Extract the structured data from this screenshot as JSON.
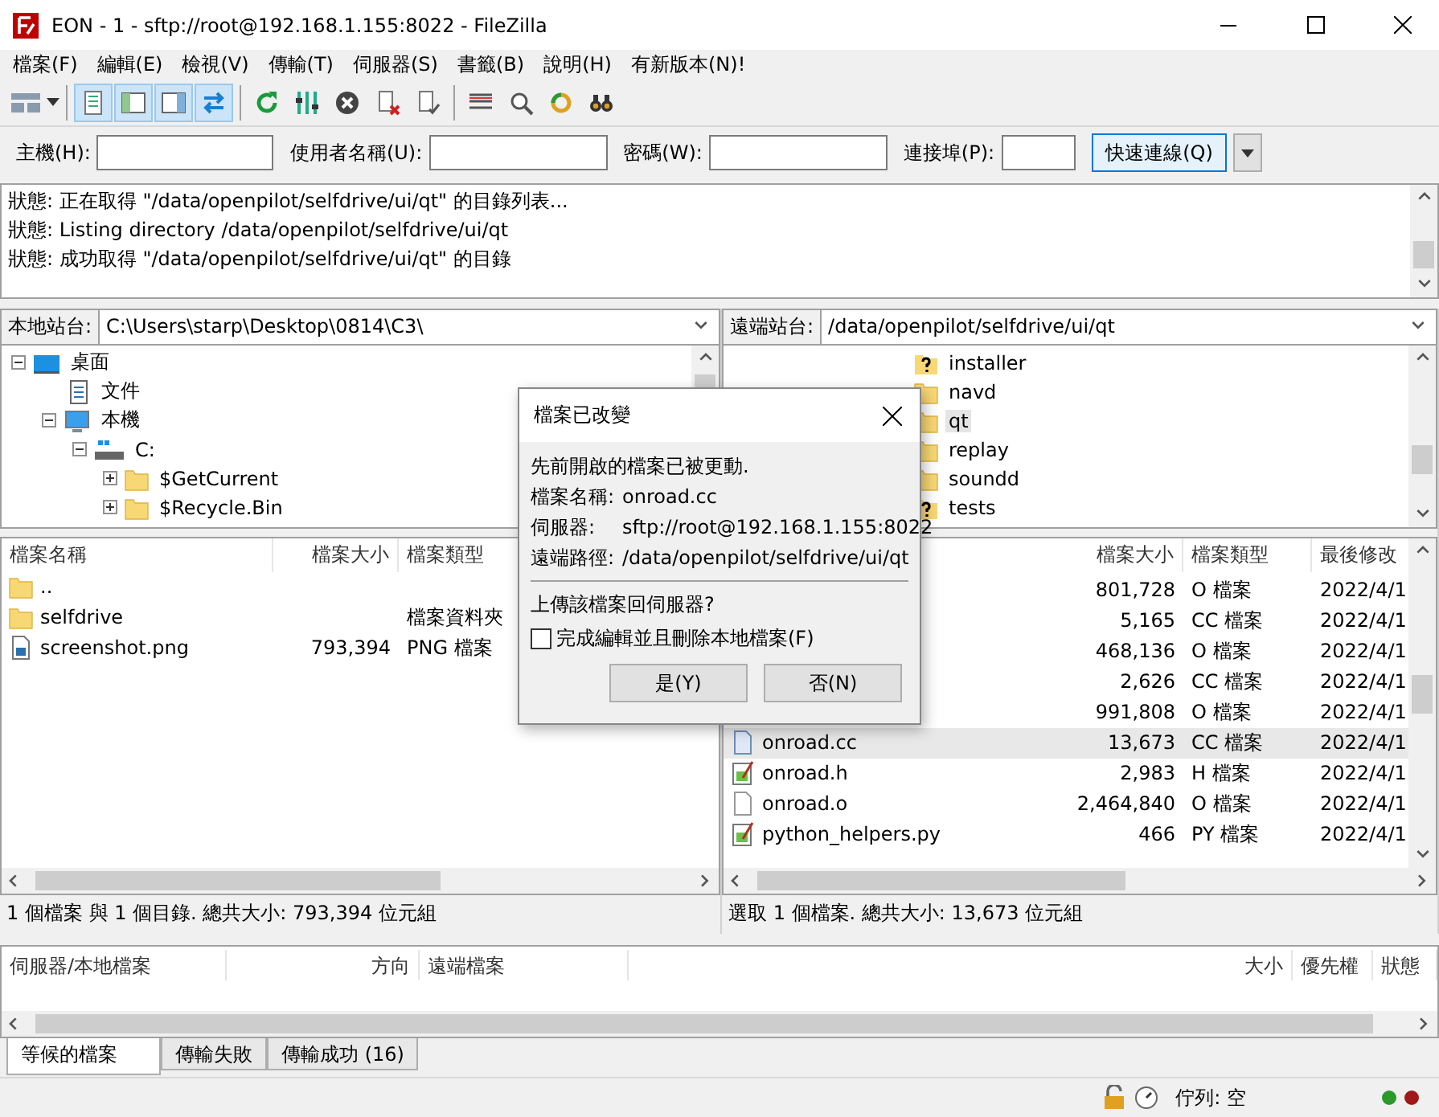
{
  "window": {
    "title": "EON - 1 - sftp://root@192.168.1.155:8022 - FileZilla"
  },
  "menu": [
    "檔案(F)",
    "編輯(E)",
    "檢視(V)",
    "傳輸(T)",
    "伺服器(S)",
    "書籤(B)",
    "說明(H)",
    "有新版本(N)!"
  ],
  "toolbar_toggles": [
    {
      "on": true
    },
    {
      "on": true
    },
    {
      "on": true
    },
    {
      "on": true
    }
  ],
  "quickconnect": {
    "fields": [
      {
        "label": "主機(H):"
      },
      {
        "label": "使用者名稱(U):"
      },
      {
        "label": "密碼(W):"
      },
      {
        "label": "連接埠(P):"
      }
    ],
    "button": "快速連線(Q)"
  },
  "log": [
    {
      "label": "狀態:",
      "text": "正在取得 \"/data/openpilot/selfdrive/ui/qt\" 的目錄列表..."
    },
    {
      "label": "狀態:",
      "text": "Listing directory /data/openpilot/selfdrive/ui/qt"
    },
    {
      "label": "狀態:",
      "text": "成功取得 \"/data/openpilot/selfdrive/ui/qt\" 的目錄"
    }
  ],
  "local": {
    "site_label": "本地站台:",
    "path": "C:\\Users\\starp\\Desktop\\0814\\C3\\",
    "tree": [
      {
        "name": "桌面",
        "kind": "desktop",
        "expanded": true,
        "children": [
          {
            "name": "文件",
            "kind": "document"
          },
          {
            "name": "本機",
            "kind": "computer",
            "expanded": true,
            "children": [
              {
                "name": "C:",
                "kind": "drive",
                "expanded": true,
                "children": [
                  {
                    "name": "$GetCurrent",
                    "kind": "folder",
                    "expanded": false
                  },
                  {
                    "name": "$Recycle.Bin",
                    "kind": "folder",
                    "expanded": false
                  }
                ]
              }
            ]
          }
        ]
      }
    ],
    "columns": [
      "檔案名稱",
      "檔案大小",
      "檔案類型"
    ],
    "files": [
      {
        "name": "..",
        "kind": "folder"
      },
      {
        "name": "selfdrive",
        "kind": "folder",
        "type": "檔案資料夾"
      },
      {
        "name": "screenshot.png",
        "kind": "image",
        "size": "793,394",
        "type": "PNG 檔案"
      }
    ],
    "status": "1 個檔案 與 1 個目錄. 總共大小: 793,394 位元組"
  },
  "remote": {
    "site_label": "遠端站台:",
    "path": "/data/openpilot/selfdrive/ui/qt",
    "tree": [
      {
        "name": "installer",
        "kind": "unknown",
        "selected": false
      },
      {
        "name": "navd",
        "kind": "folder",
        "selected": false
      },
      {
        "name": "qt",
        "kind": "folder",
        "selected": true
      },
      {
        "name": "replay",
        "kind": "folder",
        "selected": false
      },
      {
        "name": "soundd",
        "kind": "folder",
        "selected": false
      },
      {
        "name": "tests",
        "kind": "unknown",
        "selected": false
      }
    ],
    "columns": [
      "檔案大小",
      "檔案類型",
      "最後修改"
    ],
    "files": [
      {
        "size": "801,728",
        "type": "O 檔案",
        "date": "2022/4/1",
        "selected": false
      },
      {
        "size": "5,165",
        "type": "CC 檔案",
        "date": "2022/4/1",
        "selected": false
      },
      {
        "size": "468,136",
        "type": "O 檔案",
        "date": "2022/4/1",
        "selected": false
      },
      {
        "size": "2,626",
        "type": "CC 檔案",
        "date": "2022/4/1",
        "selected": false
      },
      {
        "size": "991,808",
        "type": "O 檔案",
        "date": "2022/4/1",
        "selected": false
      },
      {
        "name": "onroad.cc",
        "kind": "source",
        "size": "13,673",
        "type": "CC 檔案",
        "date": "2022/4/1",
        "selected": true
      },
      {
        "name": "onroad.h",
        "kind": "edited",
        "size": "2,983",
        "type": "H 檔案",
        "date": "2022/4/1",
        "selected": false
      },
      {
        "name": "onroad.o",
        "kind": "blank",
        "size": "2,464,840",
        "type": "O 檔案",
        "date": "2022/4/1",
        "selected": false
      },
      {
        "name": "python_helpers.py",
        "kind": "edited",
        "size": "466",
        "type": "PY 檔案",
        "date": "2022/4/1",
        "selected": false
      }
    ],
    "status": "選取 1 個檔案. 總共大小: 13,673 位元組"
  },
  "dialog": {
    "title": "檔案已改變",
    "message": "先前開啟的檔案已被更動.",
    "fields": [
      {
        "label": "檔案名稱:",
        "value": "onroad.cc"
      },
      {
        "label": "伺服器:",
        "value": "sftp://root@192.168.1.155:8022"
      },
      {
        "label": "遠端路徑:",
        "value": "/data/openpilot/selfdrive/ui/qt"
      }
    ],
    "question": "上傳該檔案回伺服器?",
    "checkbox": {
      "label": "完成編輯並且刪除本地檔案(F)",
      "checked": false
    },
    "buttons": [
      "是(Y)",
      "否(N)"
    ]
  },
  "queue": {
    "columns": [
      "伺服器/本地檔案",
      "方向",
      "遠端檔案",
      "大小",
      "優先權",
      "狀態"
    ]
  },
  "tabs": [
    {
      "label": "等候的檔案",
      "selected": true
    },
    {
      "label": "傳輸失敗",
      "selected": false
    },
    {
      "label": "傳輸成功 (16)",
      "selected": false
    }
  ],
  "status_bar": {
    "queue": "佇列: 空"
  }
}
